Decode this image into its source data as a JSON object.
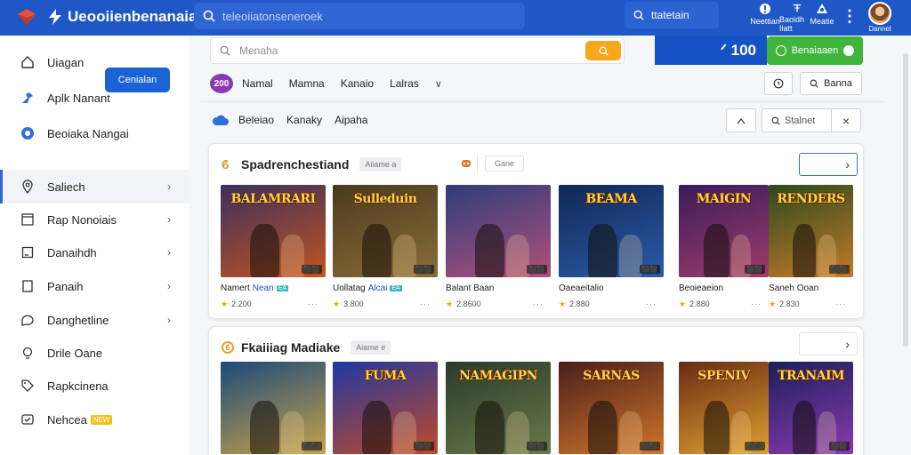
{
  "topbar": {
    "brand": "Ueooiienbenanaiari",
    "search_placeholder": "teleoiiatonseneroek",
    "action_button": "ttatetain",
    "icons": [
      {
        "name": "notifications-icon",
        "label": "Neettian"
      },
      {
        "name": "library-icon",
        "label": "Baoidh Ilatt"
      },
      {
        "name": "account-icon",
        "label": "Meatie"
      }
    ],
    "avatar_label": "Dannel"
  },
  "sidebar": {
    "cta": "Cenialan",
    "items": [
      {
        "icon": "home-icon",
        "label": "Uiagan"
      },
      {
        "icon": "puzzle-icon",
        "label": "Aplk Nanant"
      },
      {
        "icon": "compass-icon",
        "label": "Beoiaka Nangai"
      },
      {
        "icon": "location-icon",
        "label": "Saliech"
      },
      {
        "icon": "window-icon",
        "label": "Rap Nonoiais"
      },
      {
        "icon": "square-icon",
        "label": "Danaihdh"
      },
      {
        "icon": "doc-icon",
        "label": "Panaih"
      },
      {
        "icon": "chat-icon",
        "label": "Danghetline"
      },
      {
        "icon": "bulb-icon",
        "label": "Drile Oane"
      },
      {
        "icon": "tag-icon",
        "label": "Rapkcinena"
      },
      {
        "icon": "shield-icon",
        "label": "Nehcea",
        "badge": "NEW"
      }
    ]
  },
  "main": {
    "search_placeholder": "Menaha",
    "counter": "ᐟ 100",
    "green_button": "Benaiaaen",
    "tab_badge": "200",
    "tabs": [
      "Namal",
      "Mamna",
      "Kanaio",
      "Lalras"
    ],
    "view_button": "Banna",
    "filters": [
      "Beleiao",
      "Kanaky",
      "Aipaha"
    ],
    "filter_search": "Stalnet"
  },
  "sections": [
    {
      "title": "Spadrenchestiand",
      "chip": "Aiiame a",
      "tool_chip": "Gane",
      "games": [
        {
          "thumb_title": "BALAMRARI",
          "name": "Namert",
          "extra": "Nean",
          "rating": "2.200",
          "colors": [
            "#3b2f5e",
            "#c2541f"
          ]
        },
        {
          "thumb_title": "Sulleduin",
          "name": "Uollatag",
          "extra": "Alcai",
          "rating": "3.800",
          "colors": [
            "#4a3a1c",
            "#8a6d3a"
          ]
        },
        {
          "thumb_title": "",
          "name": "Balant Baan",
          "extra": "",
          "rating": "2.8600",
          "colors": [
            "#2e3d7a",
            "#b0507a"
          ]
        },
        {
          "thumb_title": "BEAMA",
          "name": "Oaeaeitalio",
          "extra": "",
          "rating": "2.880",
          "colors": [
            "#0f2855",
            "#2b5aa8"
          ]
        },
        {
          "thumb_title": "MAIGIN",
          "name": "Beoieaeion",
          "extra": "",
          "rating": "2.880",
          "colors": [
            "#3a1b5a",
            "#9c3d6a"
          ]
        },
        {
          "thumb_title": "RENDERS",
          "name": "Saneh Ooan",
          "extra": "",
          "rating": "2.830",
          "colors": [
            "#2c4a1c",
            "#c47a2a"
          ]
        }
      ]
    },
    {
      "title": "Fkaiiiag Madiake",
      "chip": "Aiame e",
      "games": [
        {
          "thumb_title": "",
          "name": "",
          "rating": "",
          "colors": [
            "#1c4a7a",
            "#c7a14a"
          ]
        },
        {
          "thumb_title": "FUMA",
          "name": "",
          "rating": "",
          "colors": [
            "#2038a0",
            "#c04a28"
          ]
        },
        {
          "thumb_title": "NAMAGIPN",
          "name": "",
          "rating": "",
          "colors": [
            "#2a3a2a",
            "#6a7a4a"
          ]
        },
        {
          "thumb_title": "SARNAS",
          "name": "",
          "rating": "",
          "colors": [
            "#4a1e1a",
            "#d0762a"
          ]
        },
        {
          "thumb_title": "SPENIV",
          "name": "",
          "rating": "",
          "colors": [
            "#6a2a14",
            "#e0a030"
          ]
        },
        {
          "thumb_title": "TRANAIM",
          "name": "",
          "rating": "",
          "colors": [
            "#1a1f5a",
            "#8a3ab0"
          ]
        }
      ]
    }
  ]
}
